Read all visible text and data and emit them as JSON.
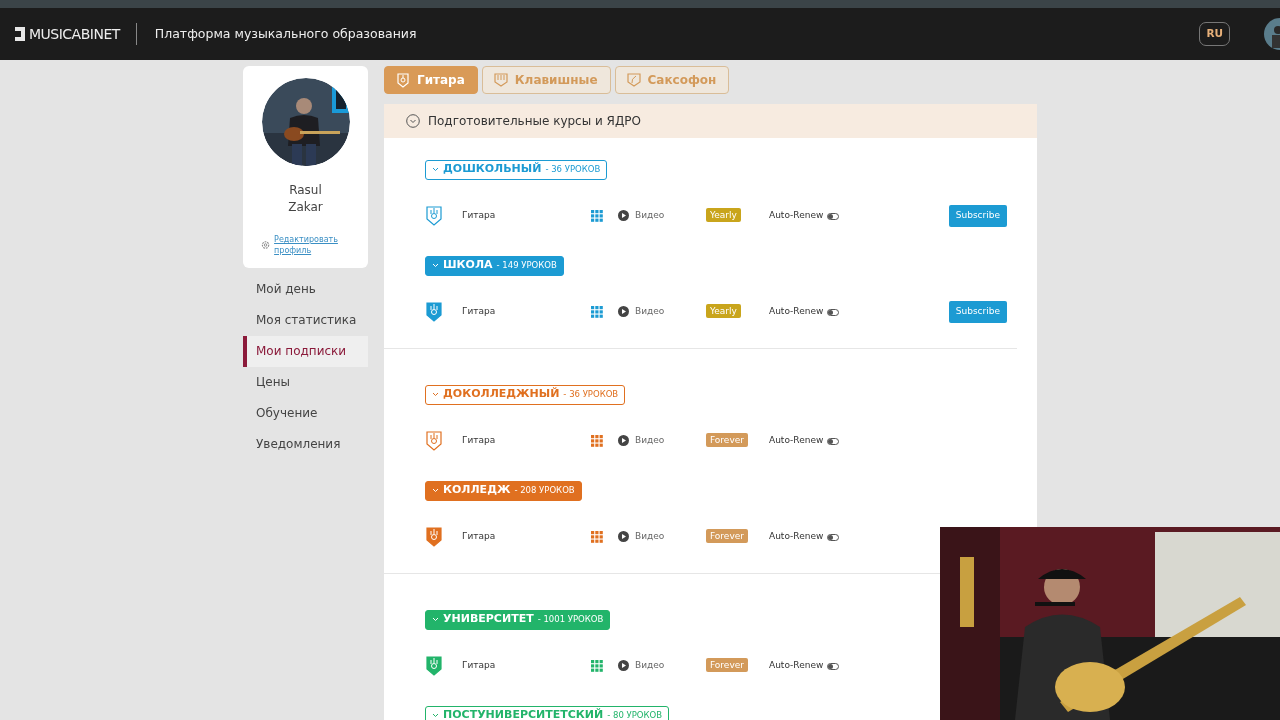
{
  "header": {
    "logo": "MUSICABINET",
    "tagline": "Платформа музыкального образования",
    "language": "RU"
  },
  "profile": {
    "first_name": "Rasul",
    "last_name": "Zakar",
    "edit_link": "Редактировать профиль"
  },
  "menu": [
    {
      "label": "Мой день",
      "selected": false
    },
    {
      "label": "Моя статистика",
      "selected": false
    },
    {
      "label": "Мои подписки",
      "selected": true
    },
    {
      "label": "Цены",
      "selected": false
    },
    {
      "label": "Обучение",
      "selected": false
    },
    {
      "label": "Уведомления",
      "selected": false
    }
  ],
  "tabs": [
    {
      "label": "Гитара",
      "selected": true,
      "kind": "guitar"
    },
    {
      "label": "Клавишные",
      "selected": false,
      "kind": "keys"
    },
    {
      "label": "Саксофон",
      "selected": false,
      "kind": "sax"
    }
  ],
  "section": {
    "title": "Подготовительные курсы и ЯДРО",
    "expanded": true
  },
  "groups": [
    {
      "levels": [
        {
          "title": "ДОШКОЛЬНЫЙ",
          "count": "- 36 УРОКОВ",
          "filled": false,
          "color": "#1c9bd3",
          "row": {
            "instrument": "Гитара",
            "media": "Видео",
            "plan": {
              "label": "Yearly",
              "color": "#c9a51c"
            },
            "auto_renew_label": "Auto-Renew",
            "auto_renew": false,
            "button": "Subscribe"
          }
        },
        {
          "title": "ШКОЛА",
          "count": "- 149 УРОКОВ",
          "filled": true,
          "color": "#1c9bd3",
          "row": {
            "instrument": "Гитара",
            "media": "Видео",
            "plan": {
              "label": "Yearly",
              "color": "#c9a51c"
            },
            "auto_renew_label": "Auto-Renew",
            "auto_renew": false,
            "button": "Subscribe"
          }
        }
      ]
    },
    {
      "levels": [
        {
          "title": "ДОКОЛЛЕДЖНЫЙ",
          "count": "- 36 УРОКОВ",
          "filled": false,
          "color": "#e07020",
          "row": {
            "instrument": "Гитара",
            "media": "Видео",
            "plan": {
              "label": "Forever",
              "color": "#d39a5a"
            },
            "auto_renew_label": "Auto-Renew",
            "auto_renew": false
          }
        },
        {
          "title": "КОЛЛЕДЖ",
          "count": "- 208 УРОКОВ",
          "filled": true,
          "color": "#e07020",
          "row": {
            "instrument": "Гитара",
            "media": "Видео",
            "plan": {
              "label": "Forever",
              "color": "#d39a5a"
            },
            "auto_renew_label": "Auto-Renew",
            "auto_renew": false
          }
        }
      ]
    },
    {
      "levels": [
        {
          "title": "УНИВЕРСИТЕТ",
          "count": "- 1001 УРОКОВ",
          "filled": true,
          "color": "#22b46a",
          "row": {
            "instrument": "Гитара",
            "media": "Видео",
            "plan": {
              "label": "Forever",
              "color": "#d39a5a"
            },
            "auto_renew_label": "Auto-Renew",
            "auto_renew": false
          }
        },
        {
          "title": "ПОСТУНИВЕРСИТЕТСКИЙ",
          "count": "- 80 УРОКОВ",
          "filled": false,
          "color": "#22b46a"
        }
      ]
    }
  ]
}
